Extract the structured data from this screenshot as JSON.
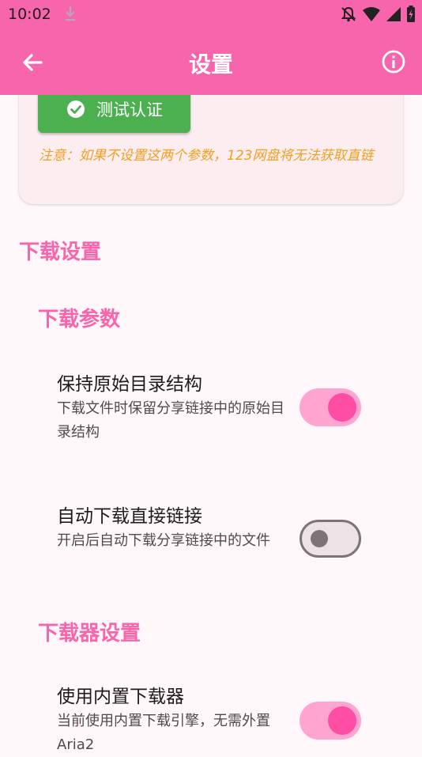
{
  "status_bar": {
    "time": "10:02",
    "icons": [
      "download-icon",
      "bell-off-icon",
      "wifi-icon",
      "signal-icon",
      "battery-charging-icon"
    ]
  },
  "app_bar": {
    "title": "设置",
    "back_icon": "arrow-left-icon",
    "info_icon": "info-icon"
  },
  "auth_card": {
    "test_button_label": "测试认证",
    "note": "注意：如果不设置这两个参数，123网盘将无法获取直链"
  },
  "download_settings": {
    "title": "下载设置",
    "params": {
      "title": "下载参数",
      "items": [
        {
          "title": "保持原始目录结构",
          "description": "下载文件时保留分享链接中的原始目录结构",
          "enabled": true
        },
        {
          "title": "自动下载直接链接",
          "description": "开启后自动下载分享链接中的文件",
          "enabled": false
        }
      ]
    },
    "downloader": {
      "title": "下载器设置",
      "items": [
        {
          "title": "使用内置下载器",
          "description": "当前使用内置下载引擎，无需外置Aria2",
          "enabled": true
        }
      ]
    }
  },
  "colors": {
    "primary": "#F765AC",
    "background": "#FFF7F9",
    "card": "#FCEDF1",
    "success": "#4CAF50",
    "warning_text": "#F0A020"
  }
}
